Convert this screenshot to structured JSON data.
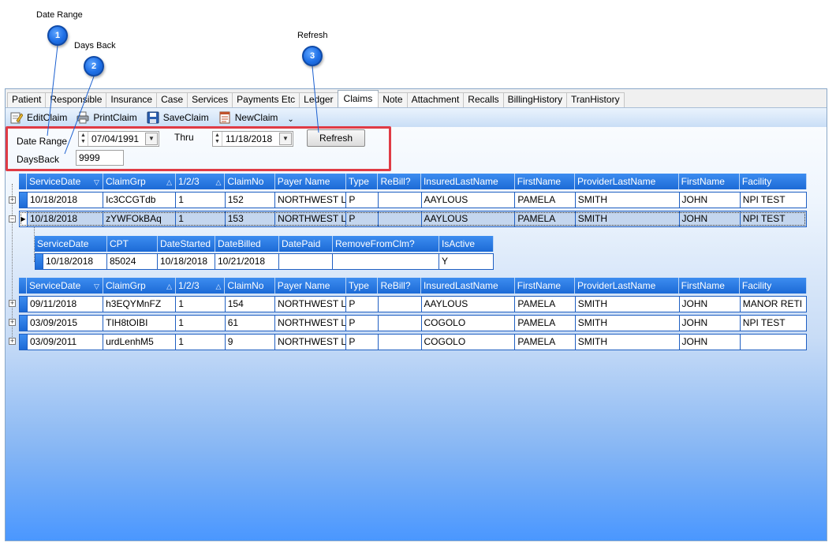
{
  "callouts": [
    {
      "number": "1",
      "label": "Date Range"
    },
    {
      "number": "2",
      "label": "Days Back"
    },
    {
      "number": "3",
      "label": "Refresh"
    }
  ],
  "tabs": [
    "Patient",
    "Responsible",
    "Insurance",
    "Case",
    "Services",
    "Payments Etc",
    "Ledger",
    "Claims",
    "Note",
    "Attachment",
    "Recalls",
    "BillingHistory",
    "TranHistory"
  ],
  "active_tab": "Claims",
  "toolbar": {
    "edit_label": "EditClaim",
    "print_label": "PrintClaim",
    "save_label": "SaveClaim",
    "new_label": "NewClaim",
    "overflow_label": "⌄"
  },
  "filters": {
    "date_range_label": "Date Range",
    "from_date": "07/04/1991",
    "thru_label": "Thru",
    "thru_date": "11/18/2018",
    "refresh_label": "Refresh",
    "days_back_label": "DaysBack",
    "days_back_value": "9999"
  },
  "claims_columns": [
    "ServiceDate",
    "ClaimGrp",
    "1/2/3",
    "ClaimNo",
    "Payer Name",
    "Type",
    "ReBill?",
    "InsuredLastName",
    "FirstName",
    "ProviderLastName",
    "FirstName",
    "Facility"
  ],
  "claims_top": [
    [
      "10/18/2018",
      "Ic3CCGTdb",
      "1",
      "152",
      "NORTHWEST L",
      "P",
      "",
      "AAYLOUS",
      "PAMELA",
      "SMITH",
      "JOHN",
      "NPI TEST"
    ],
    [
      "10/18/2018",
      "zYWFOkBAq",
      "1",
      "153",
      "NORTHWEST L",
      "P",
      "",
      "AAYLOUS",
      "PAMELA",
      "SMITH",
      "JOHN",
      "NPI TEST"
    ]
  ],
  "detail_columns": [
    "ServiceDate",
    "CPT",
    "DateStarted",
    "DateBilled",
    "DatePaid",
    "RemoveFromClm?",
    "IsActive"
  ],
  "detail_rows": [
    [
      "10/18/2018",
      "85024",
      "10/18/2018",
      "10/21/2018",
      "",
      "",
      "Y"
    ]
  ],
  "claims_bottom": [
    [
      "09/11/2018",
      "h3EQYMnFZ",
      "1",
      "154",
      "NORTHWEST L",
      "P",
      "",
      "AAYLOUS",
      "PAMELA",
      "SMITH",
      "JOHN",
      "MANOR RETI"
    ],
    [
      "03/09/2015",
      "TIH8tOIBI",
      "1",
      "61",
      "NORTHWEST L",
      "P",
      "",
      "COGOLO",
      "PAMELA",
      "SMITH",
      "JOHN",
      "NPI TEST"
    ],
    [
      "03/09/2011",
      "urdLenhM5",
      "1",
      "9",
      "NORTHWEST L",
      "P",
      "",
      "COGOLO",
      "PAMELA",
      "SMITH",
      "JOHN",
      ""
    ]
  ],
  "icons": {
    "expand": "+",
    "collapse": "−",
    "sort_desc": "▽",
    "sort_asc": "△",
    "row_pointer": "▶",
    "spin": "▲▼",
    "dropdown": "▼"
  }
}
